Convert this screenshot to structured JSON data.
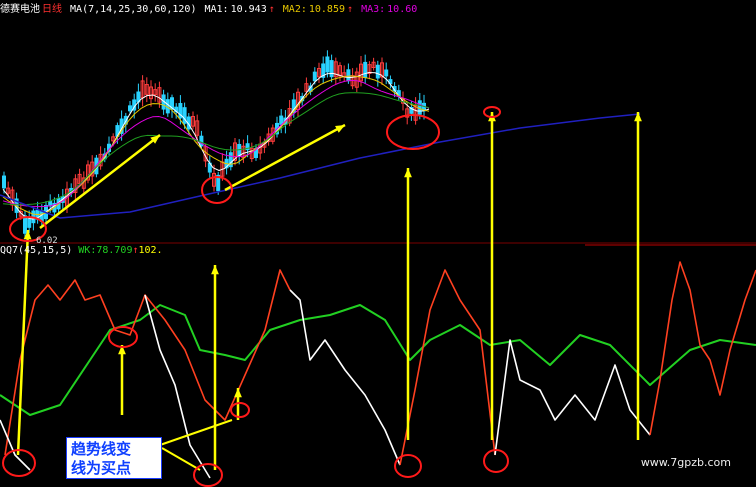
{
  "header": {
    "stock_name": "德赛电池",
    "period": "日线",
    "ma_label": "MA(7,14,25,30,60,120)",
    "ma1_label": "MA1:",
    "ma1_value": "10.943",
    "ma2_label": "MA2:",
    "ma2_value": "10.859",
    "ma3_label": "MA3:",
    "ma3_value": "10.60",
    "arrow_up": "↑"
  },
  "sub_header": {
    "indicator": "QQ7(45,15,5)",
    "wk_label": "WK:",
    "wk_value": "78.709",
    "extra_value": "102."
  },
  "low_price_label": "6.02",
  "annotation": {
    "line1": "趋势线变",
    "line2": "线为买点"
  },
  "watermark": "www.7gpzb.com",
  "colors": {
    "background": "#000000",
    "up_candle": "#ff3c3c",
    "down_candle": "#29d3ff",
    "ma_long": "#2020c0",
    "signal_arrow": "#ffff00",
    "highlight_circle": "#ff1a1a",
    "osc_red": "#ff4020",
    "osc_white": "#ffffff",
    "osc_green": "#22d022",
    "ma1": "#ffffff",
    "ma2": "#e8c800",
    "ma3": "#e000e0"
  },
  "chart_data": [
    {
      "type": "candlestick",
      "title": "德赛电池 日线",
      "series": [
        {
          "name": "MA1",
          "value": 10.943
        },
        {
          "name": "MA2",
          "value": 10.859
        },
        {
          "name": "MA3",
          "value": 10.6
        }
      ],
      "annotations": [
        "6.02"
      ]
    },
    {
      "type": "line",
      "title": "QQ7(45,15,5)",
      "series": [
        {
          "name": "WK",
          "value": 78.709
        }
      ]
    }
  ]
}
